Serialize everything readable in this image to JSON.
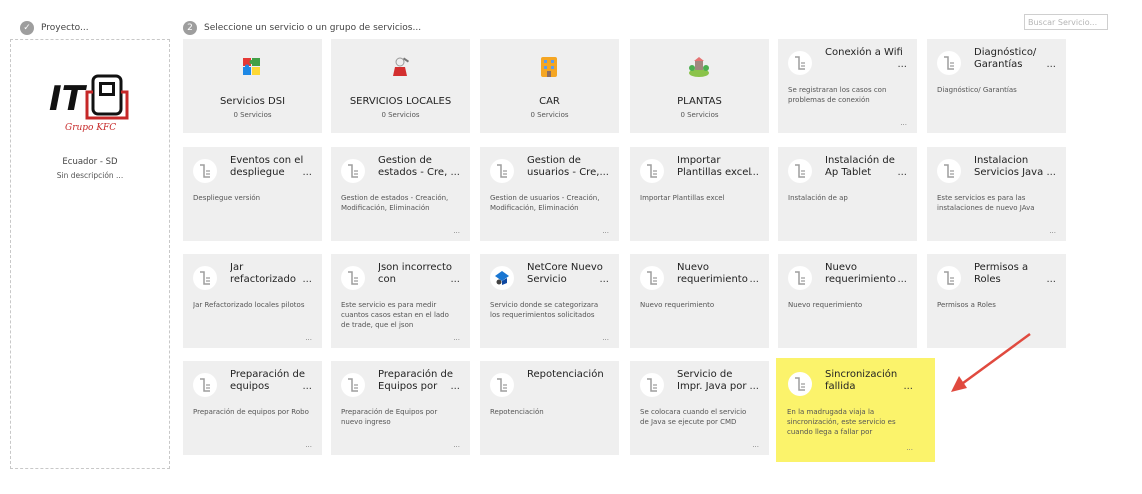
{
  "steps": [
    {
      "num": "✓",
      "label": "Proyecto..."
    },
    {
      "num": "2",
      "label": "Seleccione un servicio o un grupo de servicios..."
    }
  ],
  "search": {
    "placeholder": "Buscar Servicio..."
  },
  "project": {
    "logo_text": "IT",
    "logo_subtitle": "Grupo KFC",
    "name": "Ecuador - SD",
    "description": "Sin descripción ..."
  },
  "groups": [
    {
      "name": "Servicios DSI",
      "count": "0 Servicios",
      "icon": "puzzle-icon"
    },
    {
      "name": "SERVICIOS LOCALES",
      "count": "0 Servicios",
      "icon": "technician-icon"
    },
    {
      "name": "CAR",
      "count": "0 Servicios",
      "icon": "building-icon"
    },
    {
      "name": "PLANTAS",
      "count": "0 Servicios",
      "icon": "plant-icon"
    }
  ],
  "services": [
    {
      "title": "Conexión a Wifi",
      "desc": "Se registraran los casos con problemas de conexión",
      "icon": "document-icon"
    },
    {
      "title": "Diagnóstico/ Garantías",
      "desc": "Diagnóstico/ Garantías",
      "icon": "document-icon"
    },
    {
      "title": "Eventos con el despliegue",
      "desc": "Despliegue versión",
      "icon": "document-icon"
    },
    {
      "title": "Gestion de estados - Cre,",
      "desc": "Gestion de estados - Creación, Modificación, Eliminación",
      "icon": "document-icon"
    },
    {
      "title": "Gestion de usuarios - Cre,",
      "desc": "Gestion de usuarios - Creación, Modificación, Eliminación",
      "icon": "document-icon"
    },
    {
      "title": "Importar Plantillas excel",
      "desc": "Importar Plantillas excel",
      "icon": "document-icon"
    },
    {
      "title": "Instalación de Ap Tablet",
      "desc": "Instalación de ap",
      "icon": "document-icon"
    },
    {
      "title": "Instalacion Servicios Java",
      "desc": "Este servicios es para las instalaciones de nuevo JAva",
      "icon": "document-icon"
    },
    {
      "title": "Jar refactorizado",
      "desc": "Jar Refactorizado locales pilotos",
      "icon": "document-icon"
    },
    {
      "title": "Json incorrecto con",
      "desc": "Este servicio es para medir cuantos casos estan en el lado de trade, que el json",
      "icon": "document-icon"
    },
    {
      "title": "NetCore Nuevo Servicio",
      "desc": "Servicio donde se categorizara los requerimientos solicitados",
      "icon": "netcore-icon"
    },
    {
      "title": "Nuevo requerimiento",
      "desc": "Nuevo requerimiento",
      "icon": "document-icon"
    },
    {
      "title": "Nuevo requerimiento",
      "desc": "Nuevo requerimiento",
      "icon": "document-icon"
    },
    {
      "title": "Permisos a Roles",
      "desc": "Permisos a Roles",
      "icon": "document-icon"
    },
    {
      "title": "Preparación de equipos",
      "desc": "Preparación de equipos por Robo",
      "icon": "document-icon"
    },
    {
      "title": "Preparación de Equipos por",
      "desc": "Preparación de Equipos por nuevo ingreso",
      "icon": "document-icon"
    },
    {
      "title": "Repotenciación",
      "desc": "Repotenciación",
      "icon": "document-icon"
    },
    {
      "title": "Servicio de Impr. Java por",
      "desc": "Se colocara cuando el servicio de Java se ejecute por CMD",
      "icon": "document-icon"
    },
    {
      "title": "Sincronización fallida",
      "desc": "En la madrugada viaja la sincronización, este servicio es cuando llega a fallar por",
      "icon": "document-icon",
      "highlighted": true
    }
  ],
  "ellipsis": "...",
  "colors": {
    "highlight": "#fbf36b",
    "arrow": "#e04a3f",
    "tile": "#efefef"
  }
}
